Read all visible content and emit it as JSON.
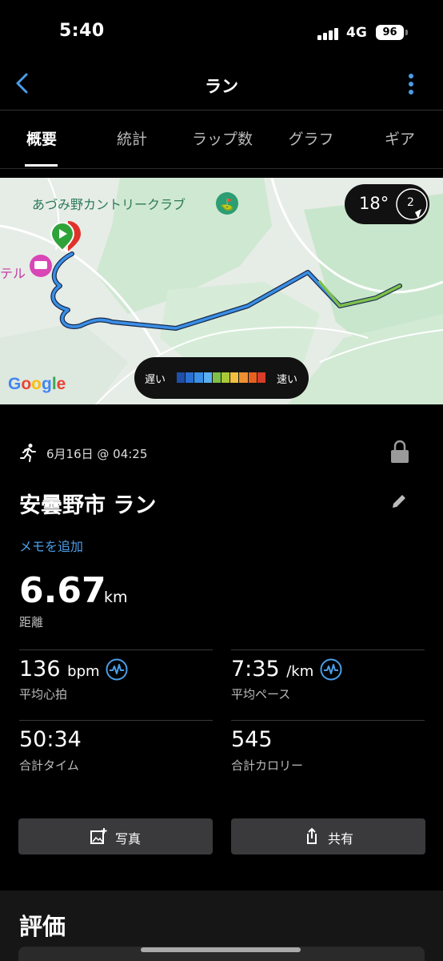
{
  "status_bar": {
    "time": "5:40",
    "network": "4G",
    "battery": "96"
  },
  "nav": {
    "title": "ラン"
  },
  "tabs": [
    "概要",
    "統計",
    "ラップ数",
    "グラフ",
    "ギア"
  ],
  "map": {
    "poi_label": "あづみ野カントリークラブ",
    "hotel_label": "テル",
    "temperature": "18°",
    "wind_speed": "2",
    "speed_legend": {
      "slow": "遅い",
      "fast": "速い",
      "colors": [
        "#1f4fa8",
        "#2a6fd1",
        "#3a8fe6",
        "#5ab0f0",
        "#7ec04a",
        "#a8c83a",
        "#f0c040",
        "#f09030",
        "#e86020",
        "#d83c2a"
      ]
    },
    "attribution": "Google",
    "route_color": "#3a8fe6",
    "route_fast_color": "#7ec04a"
  },
  "activity": {
    "date": "6月16日 @ 04:25",
    "title": "安曇野市 ラン",
    "add_note": "メモを追加",
    "distance": {
      "value": "6.67",
      "unit": "km",
      "label": "距離"
    },
    "stats": {
      "heart_rate": {
        "value": "136",
        "unit": "bpm",
        "label": "平均心拍"
      },
      "pace": {
        "value": "7:35",
        "unit": "/km",
        "label": "平均ペース"
      },
      "time": {
        "value": "50:34",
        "label": "合計タイム"
      },
      "calories": {
        "value": "545",
        "label": "合計カロリー"
      }
    }
  },
  "actions": {
    "photo": "写真",
    "share": "共有"
  },
  "rating": {
    "title": "評価"
  },
  "colors": {
    "accent": "#4a9de8",
    "background": "#000000",
    "button": "#3a3a3c"
  }
}
